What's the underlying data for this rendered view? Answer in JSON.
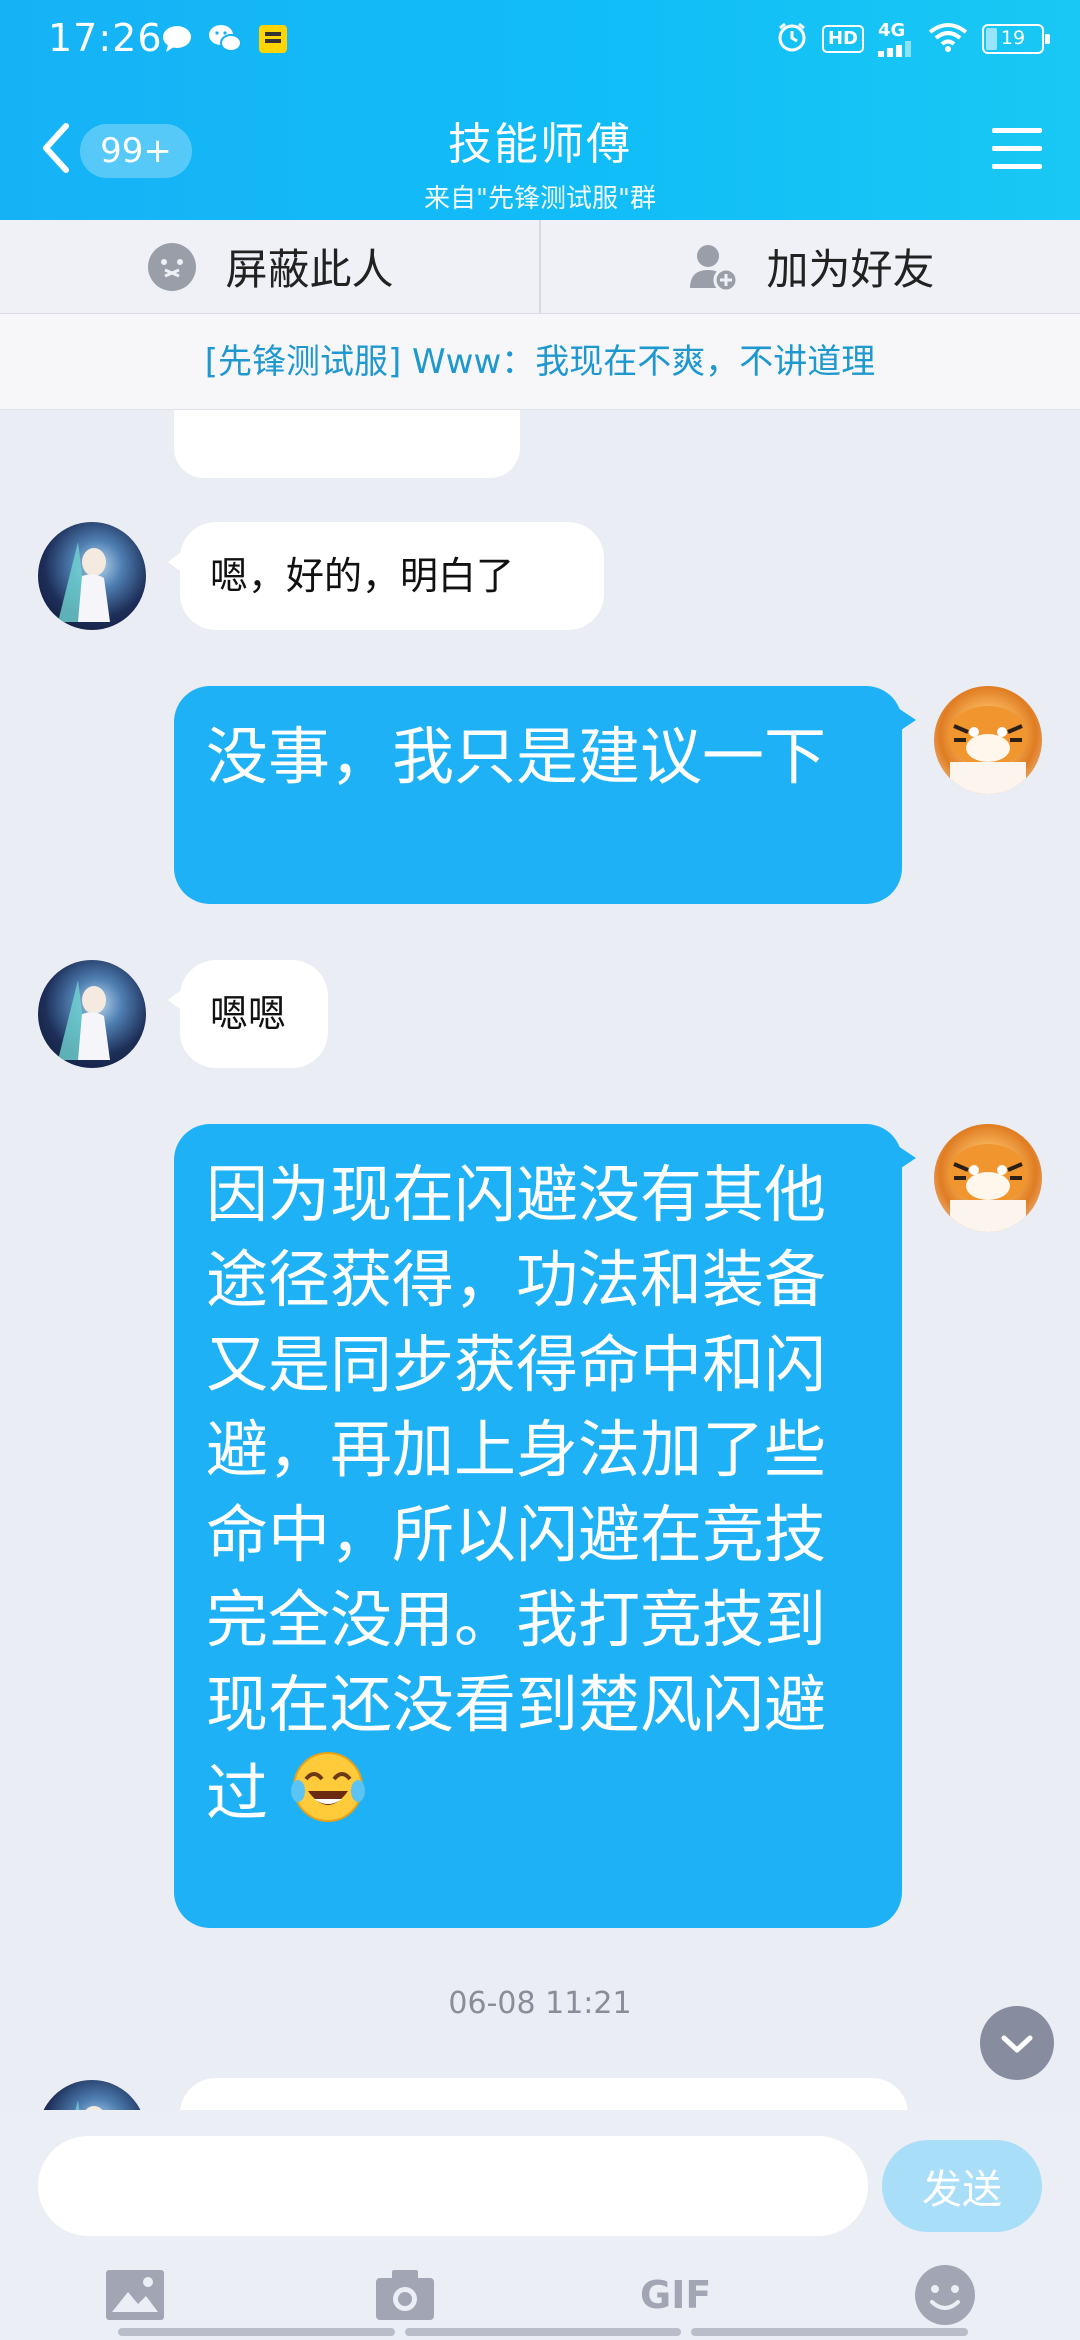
{
  "status_bar": {
    "time": "17:26",
    "network_hd": "HD",
    "network_4g": "4G",
    "battery": "19",
    "left_icons": [
      "chat-bubble-icon",
      "wechat-icon",
      "app-notification-icon"
    ],
    "right_icons": [
      "alarm-icon",
      "hd-icon",
      "signal-4g-icon",
      "wifi-icon",
      "battery-icon"
    ]
  },
  "header": {
    "unread_badge": "99+",
    "title": "技能师傅",
    "subtitle": "来自\"先锋测试服\"群",
    "accent_color": "#12B7F5"
  },
  "actions": {
    "block_label": "屏蔽此人",
    "add_friend_label": "加为好友"
  },
  "notice": {
    "text": "[先锋测试服] Www：我现在不爽，不讲道理"
  },
  "messages": [
    {
      "side": "in",
      "text": "嗯，好的，明白了"
    },
    {
      "side": "out",
      "text": "没事，我只是建议一下"
    },
    {
      "side": "in",
      "text": "嗯嗯"
    },
    {
      "side": "out",
      "text": "因为现在闪避没有其他途径获得，功法和装备又是同步获得命中和闪避，再加上身法加了些命中，所以闪避在竞技完全没用。我打竞技到现在还没看到楚风闪避过",
      "emoji": "tears-of-joy-emoji"
    }
  ],
  "timestamp": "06-08 11:21",
  "input": {
    "placeholder": "",
    "value": "",
    "send_label": "发送"
  },
  "toolbar": {
    "gif_label": "GIF",
    "icons": [
      "image-icon",
      "camera-icon",
      "gif-icon",
      "emoji-icon"
    ]
  }
}
